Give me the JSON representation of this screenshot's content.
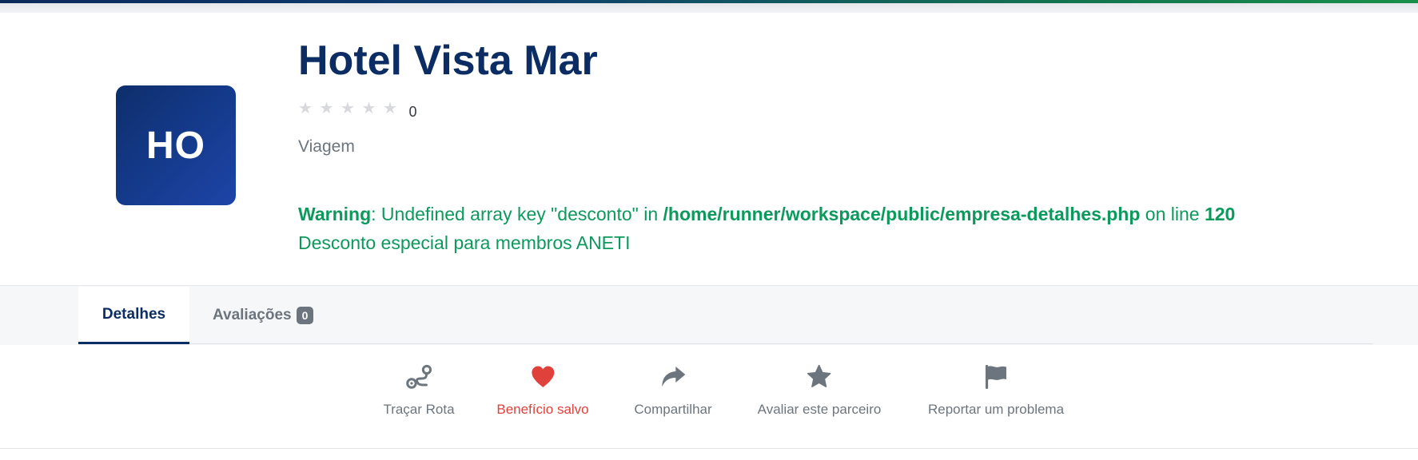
{
  "company": {
    "logo_initials": "HO",
    "name": "Hotel Vista Mar",
    "rating_count": "0",
    "category": "Viagem"
  },
  "warning": {
    "label": "Warning",
    "message": ": Undefined array key \"desconto\" in ",
    "path": "/home/runner/workspace/public/empresa-detalhes.php",
    "on_line": " on line ",
    "line": "120",
    "discount_text": "Desconto especial para membros ANETI"
  },
  "tabs": {
    "details": "Detalhes",
    "reviews": "Avaliações",
    "reviews_count": "0"
  },
  "actions": {
    "route": "Traçar Rota",
    "saved": "Benefício salvo",
    "share": "Compartilhar",
    "rate": "Avaliar este parceiro",
    "report": "Reportar um problema"
  },
  "colors": {
    "brand_navy": "#0c2d63",
    "warning_green": "#0c9a5c",
    "saved_red": "#e0413a",
    "muted_gray": "#6c757d"
  }
}
